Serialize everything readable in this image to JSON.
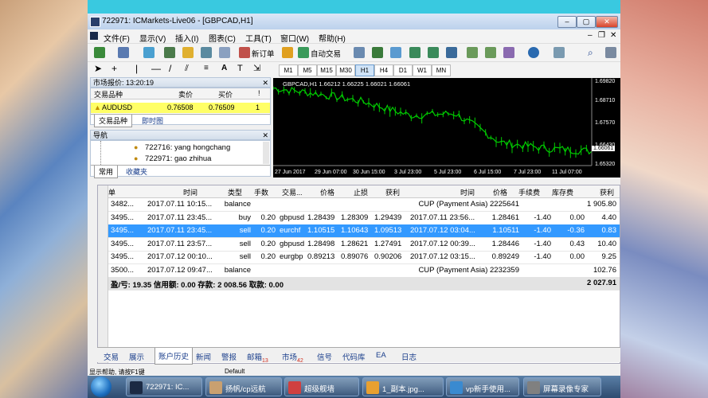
{
  "window": {
    "title": "722971: ICMarkets-Live06 - [GBPCAD,H1]"
  },
  "menu": [
    "文件(F)",
    "显示(V)",
    "插入(I)",
    "图表(C)",
    "工具(T)",
    "窗口(W)",
    "帮助(H)"
  ],
  "toolbar": {
    "new_order": "新订单",
    "auto_trading": "自动交易"
  },
  "timeframes": [
    "M1",
    "M5",
    "M15",
    "M30",
    "H1",
    "H4",
    "D1",
    "W1",
    "MN"
  ],
  "active_timeframe": "H1",
  "market_watch": {
    "title": "市场报价: 13:20:19",
    "headers": [
      "交易品种",
      "卖价",
      "买价",
      "!"
    ],
    "rows": [
      {
        "symbol": "AUDUSD",
        "bid": "0.76508",
        "ask": "0.76509",
        "spread": "1"
      }
    ],
    "tabs": [
      "交易品种",
      "即时图"
    ]
  },
  "navigator": {
    "title": "导航",
    "accounts": [
      "722716: yang hongchang",
      "722971: gao zhihua"
    ],
    "tabs": [
      "常用",
      "收藏夹"
    ]
  },
  "chart": {
    "header": "GBPCAD,H1  1.66212 1.66225 1.66021 1.66061",
    "price_labels": [
      "1.69820",
      "1.68710",
      "1.67570",
      "1.66430",
      "1.66061",
      "1.65320"
    ],
    "time_labels": [
      "27 Jun 2017",
      "29 Jun 07:00",
      "30 Jun 15:00",
      "3 Jul 23:00",
      "5 Jul 23:00",
      "6 Jul 15:00",
      "7 Jul 23:00",
      "11 Jul 07:00"
    ],
    "current_price": "1.66061"
  },
  "chart_data": {
    "type": "line",
    "x": [
      "27 Jun 2017",
      "29 Jun 07:00",
      "30 Jun 15:00",
      "3 Jul 23:00",
      "5 Jul 23:00",
      "6 Jul 15:00",
      "7 Jul 23:00",
      "11 Jul 07:00"
    ],
    "series": [
      {
        "values": [
          1.693,
          1.69,
          1.686,
          1.679,
          1.68,
          1.665,
          1.662,
          1.6606
        ]
      }
    ],
    "ylim": [
      1.6532,
      1.6982
    ],
    "grid": false
  },
  "terminal": {
    "headers": [
      "订单",
      "时间",
      "类型",
      "手数",
      "交易...",
      "价格",
      "止损",
      "获利",
      "时间",
      "价格",
      "手续费",
      "库存费",
      "获利"
    ],
    "rows": [
      {
        "order": "3482...",
        "time": "2017.07.11 10:15...",
        "type": "balance",
        "lots": "",
        "symbol": "",
        "price": "",
        "sl": "",
        "tp": "",
        "ctime": "",
        "cprice": "CUP (Payment Asia) 2225641",
        "comm": "",
        "swap": "",
        "profit": "1 905.80",
        "sel": false
      },
      {
        "order": "3495...",
        "time": "2017.07.11 23:45...",
        "type": "buy",
        "lots": "0.20",
        "symbol": "gbpusd",
        "price": "1.28439",
        "sl": "1.28309",
        "tp": "1.29439",
        "ctime": "2017.07.11 23:56...",
        "cprice": "1.28461",
        "comm": "-1.40",
        "swap": "0.00",
        "profit": "4.40",
        "sel": false
      },
      {
        "order": "3495...",
        "time": "2017.07.11 23:45...",
        "type": "sell",
        "lots": "0.20",
        "symbol": "eurchf",
        "price": "1.10515",
        "sl": "1.10643",
        "tp": "1.09513",
        "ctime": "2017.07.12 03:04...",
        "cprice": "1.10511",
        "comm": "-1.40",
        "swap": "-0.36",
        "profit": "0.83",
        "sel": true
      },
      {
        "order": "3495...",
        "time": "2017.07.11 23:57...",
        "type": "sell",
        "lots": "0.20",
        "symbol": "gbpusd",
        "price": "1.28498",
        "sl": "1.28621",
        "tp": "1.27491",
        "ctime": "2017.07.12 00:39...",
        "cprice": "1.28446",
        "comm": "-1.40",
        "swap": "0.43",
        "profit": "10.40",
        "sel": false
      },
      {
        "order": "3495...",
        "time": "2017.07.12 00:10...",
        "type": "sell",
        "lots": "0.20",
        "symbol": "eurgbp",
        "price": "0.89213",
        "sl": "0.89076",
        "tp": "0.90206",
        "ctime": "2017.07.12 03:15...",
        "cprice": "0.89249",
        "comm": "-1.40",
        "swap": "0.00",
        "profit": "9.25",
        "sel": false
      },
      {
        "order": "3500...",
        "time": "2017.07.12 09:47...",
        "type": "balance",
        "lots": "",
        "symbol": "",
        "price": "",
        "sl": "",
        "tp": "",
        "ctime": "",
        "cprice": "CUP (Payment Asia) 2232359",
        "comm": "",
        "swap": "",
        "profit": "102.76",
        "sel": false
      }
    ],
    "summary": {
      "text": "盈/亏: 19.35  信用额: 0.00  存款: 2 008.56  取款: 0.00",
      "total": "2 027.91"
    },
    "tabs": [
      {
        "label": "交易",
        "badge": ""
      },
      {
        "label": "展示",
        "badge": ""
      },
      {
        "label": "账户历史",
        "badge": ""
      },
      {
        "label": "新闻",
        "badge": ""
      },
      {
        "label": "警报",
        "badge": ""
      },
      {
        "label": "邮箱",
        "badge": "13"
      },
      {
        "label": "市场",
        "badge": "42"
      },
      {
        "label": "信号",
        "badge": ""
      },
      {
        "label": "代码库",
        "badge": ""
      },
      {
        "label": "EA",
        "badge": ""
      },
      {
        "label": "日志",
        "badge": ""
      }
    ],
    "active_tab": "账户历史"
  },
  "statusbar": {
    "left": "显示帮助, 请按F1键",
    "center": "Default"
  },
  "taskbar": {
    "items": [
      {
        "label": "722971: IC...",
        "color": "#1b2a44"
      },
      {
        "label": "扬帆/cp远航",
        "color": "#c9a070"
      },
      {
        "label": "超级舰墙",
        "color": "#d04040"
      },
      {
        "label": "1_副本.jpg...",
        "color": "#e8a030"
      },
      {
        "label": "vp新手使用...",
        "color": "#3a8ad0"
      },
      {
        "label": "屏幕录像专家",
        "color": "#808080"
      }
    ]
  }
}
